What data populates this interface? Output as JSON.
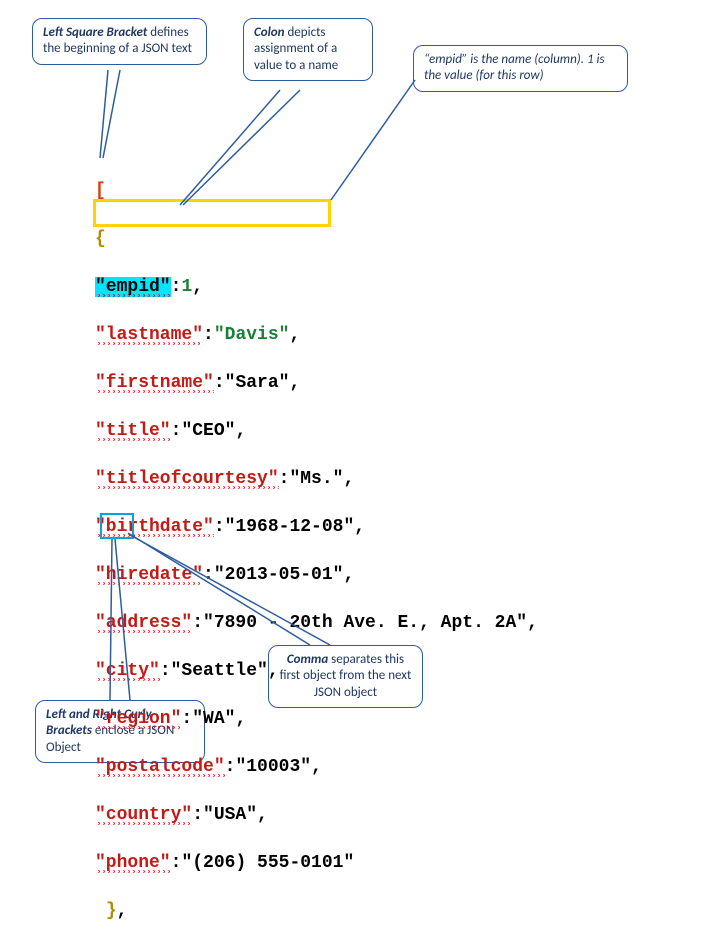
{
  "callouts": {
    "left_bracket": {
      "bold": "Left Square Bracket",
      "rest": " defines the beginning of a JSON text"
    },
    "colon": {
      "bold": "Colon",
      "rest": " depicts assignment of a value to a name"
    },
    "empid_note": "“empid” is the name (column). 1 is the value (for this row)",
    "curly": {
      "bold": "Left and Right Curly Brackets",
      "rest": " enclose a JSON Object"
    },
    "comma": {
      "bold": "Comma",
      "rest": " separates this first object from the next JSON object"
    }
  },
  "json_sample": {
    "open_bracket": "[",
    "open_brace": "{",
    "fields": [
      {
        "key": "\"empid\"",
        "colon": ":",
        "value": "1",
        "trailing": ",",
        "value_type": "number",
        "highlight": true
      },
      {
        "key": "\"lastname\"",
        "colon": ":",
        "value": "\"Davis\"",
        "trailing": ",",
        "value_type": "green"
      },
      {
        "key": "\"firstname\"",
        "colon": ":",
        "value": "\"Sara\"",
        "trailing": ",",
        "value_type": "string"
      },
      {
        "key": "\"title\"",
        "colon": ":",
        "value": "\"CEO\"",
        "trailing": ",",
        "value_type": "string"
      },
      {
        "key": "\"titleofcourtesy\"",
        "colon": ":",
        "value": "\"Ms.\"",
        "trailing": ",",
        "value_type": "string"
      },
      {
        "key": "\"birthdate\"",
        "colon": ":",
        "value": "\"1968-12-08\"",
        "trailing": ",",
        "value_type": "string"
      },
      {
        "key": "\"hiredate\"",
        "colon": ":",
        "value": "\"2013-05-01\"",
        "trailing": ",",
        "value_type": "string"
      },
      {
        "key": "\"address\"",
        "colon": ":",
        "value": "\"7890 - 20th Ave. E., Apt. 2A\"",
        "trailing": ",",
        "value_type": "string"
      },
      {
        "key": "\"city\"",
        "colon": ":",
        "value": "\"Seattle\"",
        "trailing": ",",
        "value_type": "string"
      },
      {
        "key": "\"region\"",
        "colon": ":",
        "value": "\"WA\"",
        "trailing": ",",
        "value_type": "string"
      },
      {
        "key": "\"postalcode\"",
        "colon": ":",
        "value": "\"10003\"",
        "trailing": ",",
        "value_type": "string"
      },
      {
        "key": "\"country\"",
        "colon": ":",
        "value": "\"USA\"",
        "trailing": ",",
        "value_type": "string"
      },
      {
        "key": "\"phone\"",
        "colon": ":",
        "value": "\"(206) 555-0101\"",
        "trailing": "",
        "value_type": "string"
      }
    ],
    "close_brace": "}",
    "close_comma": ","
  }
}
